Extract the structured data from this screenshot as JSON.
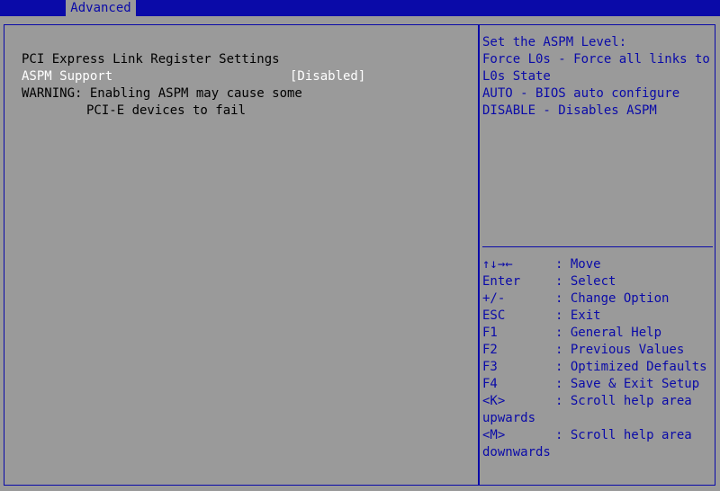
{
  "topbar": {
    "tab_label": "Advanced"
  },
  "main": {
    "section_title": "PCI Express Link Register Settings",
    "setting": {
      "label": "ASPM Support",
      "value": "[Disabled]"
    },
    "warning_line1": "WARNING: Enabling ASPM may cause some",
    "warning_line2": "PCI-E devices to fail"
  },
  "help": {
    "lines": [
      "Set the ASPM Level:",
      "Force L0s - Force all links to",
      "L0s State",
      "AUTO - BIOS auto configure",
      "DISABLE - Disables ASPM"
    ]
  },
  "keys": [
    {
      "key": "↑↓→←",
      "desc": ": Move"
    },
    {
      "key": "Enter",
      "desc": ": Select"
    },
    {
      "key": "+/-",
      "desc": ": Change Option"
    },
    {
      "key": "ESC",
      "desc": ": Exit"
    },
    {
      "key": "F1",
      "desc": ": General Help"
    },
    {
      "key": "F2",
      "desc": ": Previous Values"
    },
    {
      "key": "F3",
      "desc": ": Optimized Defaults"
    },
    {
      "key": "F4",
      "desc": ": Save & Exit Setup"
    },
    {
      "key": "<K>",
      "desc": ": Scroll help area"
    },
    {
      "key": "upwards",
      "desc": ""
    },
    {
      "key": "<M>",
      "desc": ": Scroll help area"
    },
    {
      "key": "downwards",
      "desc": ""
    }
  ],
  "colors": {
    "background": "#9a9a9a",
    "accent_blue": "#0a0aa8",
    "highlight": "#ffffff"
  }
}
